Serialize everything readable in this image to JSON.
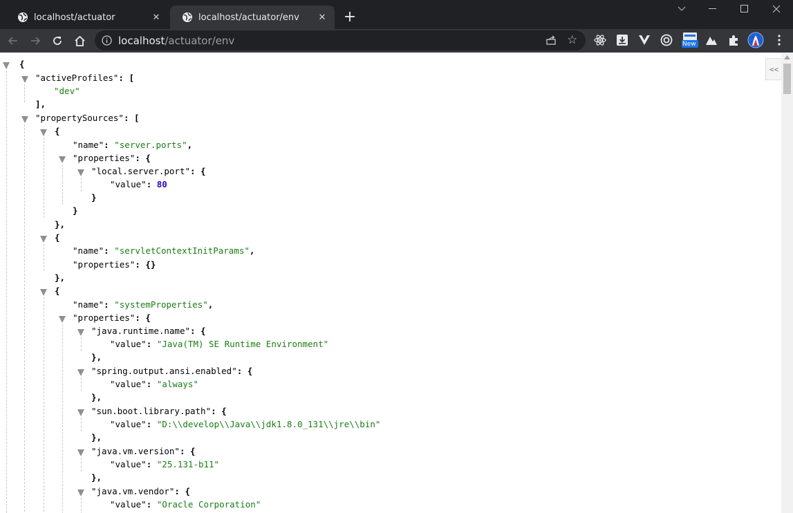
{
  "browser": {
    "tabs": [
      {
        "title": "localhost/actuator",
        "active": false
      },
      {
        "title": "localhost/actuator/env",
        "active": true
      }
    ],
    "new_tab_icon": "+",
    "close_icon": "✕",
    "url_host": "localhost",
    "url_path": "/actuator/env",
    "ext_badge": "New"
  },
  "viewer": {
    "collapse_label": "<<"
  },
  "json_lines": {
    "l0": "{",
    "l1_key": "activeProfiles",
    "l1_tail": ": [",
    "l2_val": "dev",
    "l3": "],",
    "l4_key": "propertySources",
    "l4_tail": ": [",
    "l5": "{",
    "l6_key": "name",
    "l6_val": "server.ports",
    "l7_key": "properties",
    "l7_tail": ": {",
    "l8_key": "local.server.port",
    "l8_tail": ": {",
    "l9_key": "value",
    "l9_val": "80",
    "l10": "}",
    "l11": "}",
    "l12": "},",
    "l13": "{",
    "l14_key": "name",
    "l14_val": "servletContextInitParams",
    "l15_key": "properties",
    "l15_tail": ": {}",
    "l16": "},",
    "l17": "{",
    "l18_key": "name",
    "l18_val": "systemProperties",
    "l19_key": "properties",
    "l19_tail": ": {",
    "l20_key": "java.runtime.name",
    "l20_tail": ": {",
    "l21_key": "value",
    "l21_val": "Java(TM) SE Runtime Environment",
    "l22": "},",
    "l23_key": "spring.output.ansi.enabled",
    "l23_tail": ": {",
    "l24_key": "value",
    "l24_val": "always",
    "l25": "},",
    "l26_key": "sun.boot.library.path",
    "l26_tail": ": {",
    "l27_key": "value",
    "l27_val": "D:\\\\develop\\\\Java\\\\jdk1.8.0_131\\\\jre\\\\bin",
    "l28": "},",
    "l29_key": "java.vm.version",
    "l29_tail": ": {",
    "l30_key": "value",
    "l30_val": "25.131-b11",
    "l31": "},",
    "l32_key": "java.vm.vendor",
    "l32_tail": ": {",
    "l33_key": "value",
    "l33_val": "Oracle Corporation"
  }
}
